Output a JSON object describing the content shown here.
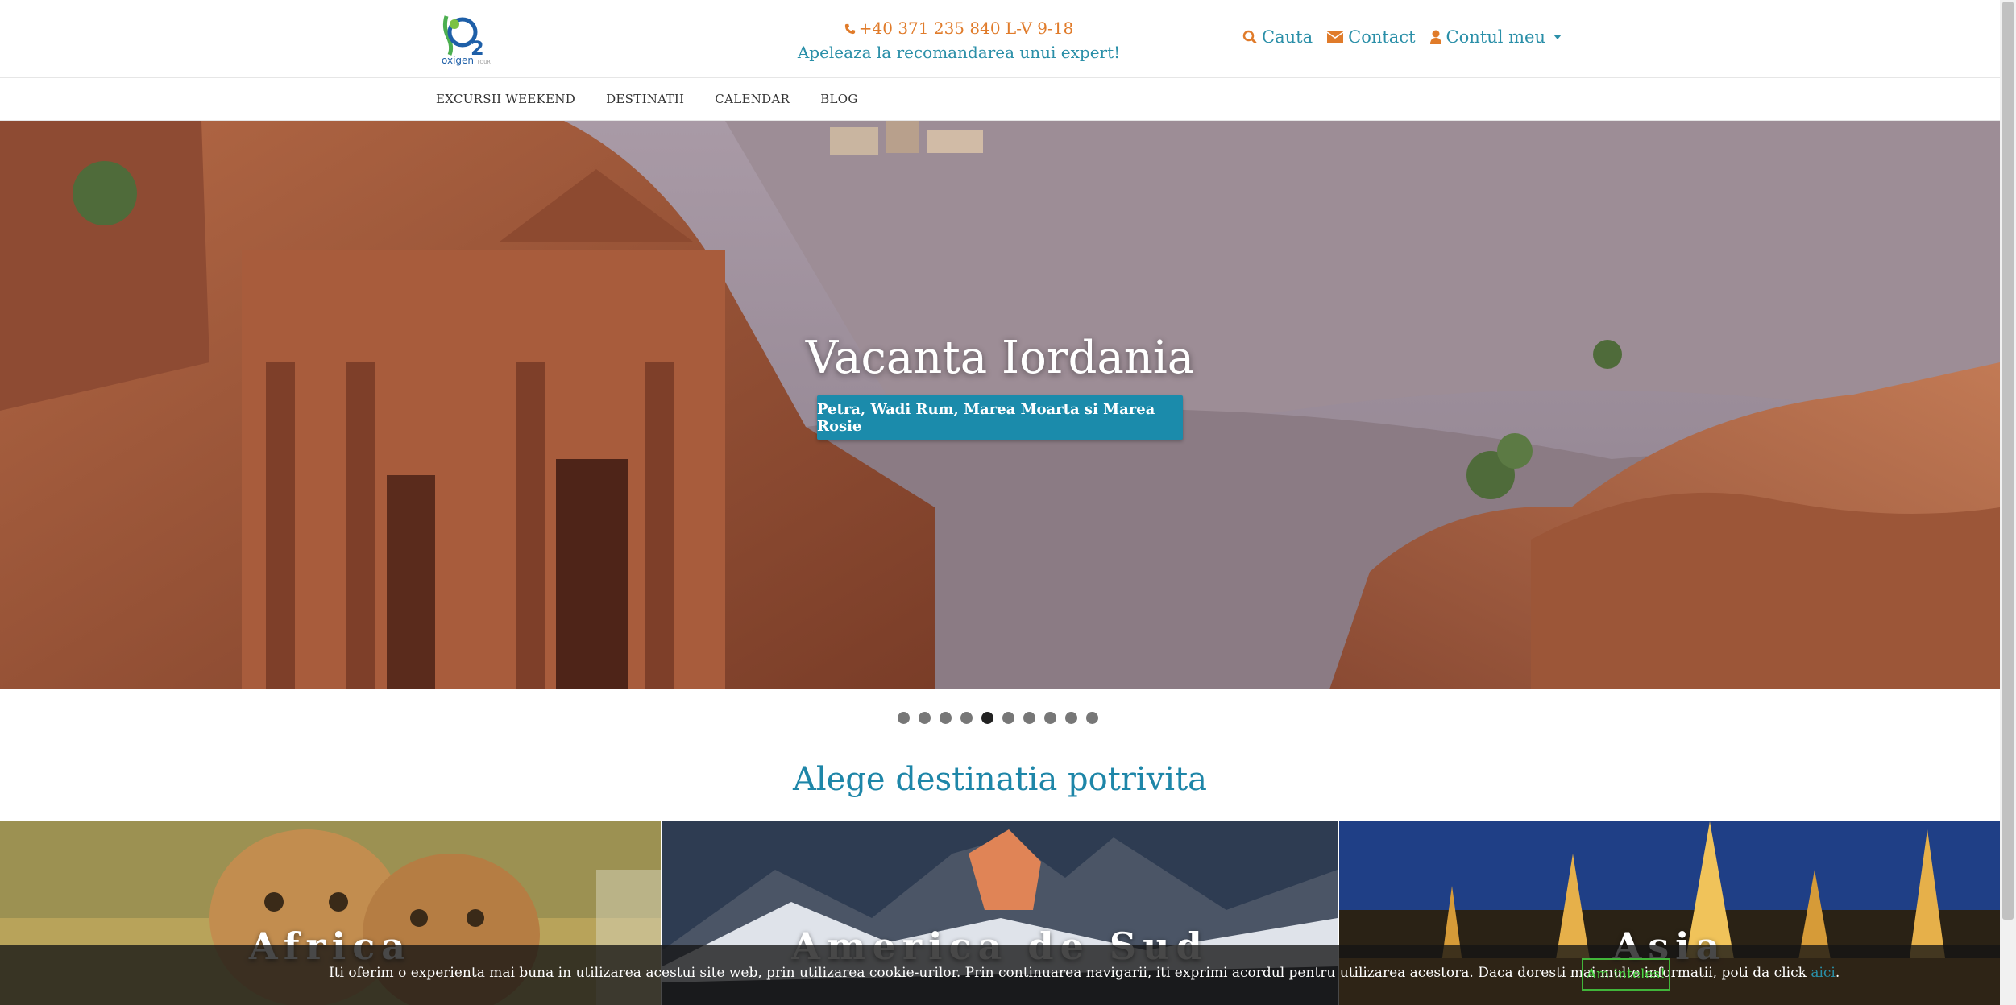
{
  "header": {
    "logo_text": "oxigen",
    "logo_small": "TOUR",
    "phone": "+40 371 235 840 L-V 9-18",
    "expert": "Apeleaza la recomandarea unui expert!",
    "links": {
      "search": "Cauta",
      "contact": "Contact",
      "account": "Contul meu"
    }
  },
  "nav": {
    "items": [
      "EXCURSII WEEKEND",
      "DESTINATII",
      "CALENDAR",
      "BLOG"
    ]
  },
  "hero": {
    "title": "Vacanta Iordania",
    "button": "Petra, Wadi Rum, Marea Moarta si Marea Rosie",
    "slides_total": 10,
    "active_slide": 5
  },
  "section": {
    "title": "Alege destinatia potrivita"
  },
  "tiles": [
    "Africa",
    "America de Sud",
    "Asia"
  ],
  "cookie": {
    "text": "Iti oferim o experienta mai buna in utilizarea acestui site web, prin utilizarea cookie-urilor. Prin continuarea navigarii, iti exprimi acordul pentru utilizarea acestora. Daca doresti mai multe informatii, poti da click ",
    "link": "aici",
    "after": ".",
    "button": "Am inteles!"
  },
  "colors": {
    "accent": "#1e86a8",
    "orange": "#e07b2a",
    "button": "#1b8bab",
    "cookie_green": "#41b53a"
  }
}
